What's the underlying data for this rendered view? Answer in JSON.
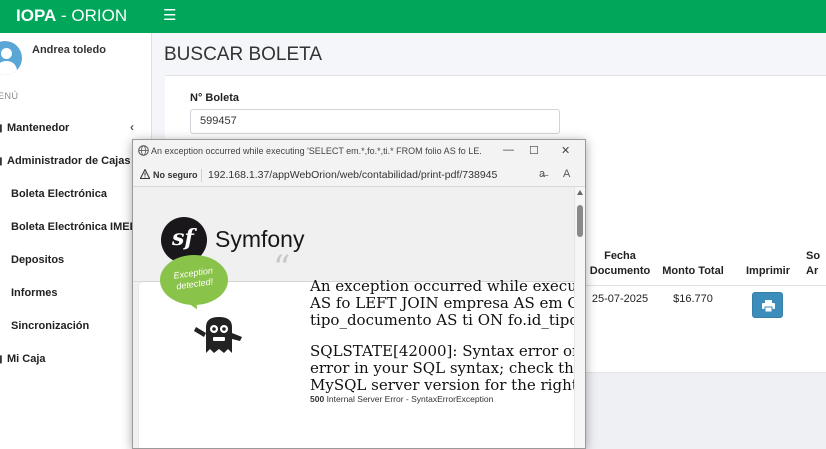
{
  "brand": {
    "bold": "IOPA",
    "rest": " - ORION"
  },
  "sidebar": {
    "user_name": "Andrea toledo",
    "menu_header": "ENÚ",
    "items": [
      {
        "label": "Mantenedor"
      },
      {
        "label": "Administrador de Cajas"
      },
      {
        "label": "Boleta Electrónica"
      },
      {
        "label": "Boleta Electrónica IMED"
      },
      {
        "label": "Depositos"
      },
      {
        "label": "Informes"
      },
      {
        "label": "Sincronización"
      },
      {
        "label": "Mi Caja"
      }
    ]
  },
  "main": {
    "title": "BUSCAR BOLETA",
    "form": {
      "label": "N° Boleta",
      "value": "599457"
    },
    "table": {
      "headers": {
        "fecha": "Fecha Documento",
        "fecha_l1": "Fecha",
        "fecha_l2": "Documento",
        "monto": "Monto Total",
        "imprimir": "Imprimir",
        "next_l1": "So",
        "next_l2": "Ar"
      },
      "rows": [
        {
          "fecha": "25-07-2025",
          "monto": "$16.770"
        }
      ]
    }
  },
  "popup": {
    "title": "An exception occurred while executing 'SELECT em.*,fo.*,ti.* FROM folio AS fo LE...",
    "security": "No seguro",
    "url": "192.168.1.37/appWebOrion/web/contabilidad/print-pdf/738945",
    "framework": "Symfony",
    "badge": "Exception detected!",
    "badge_l1": "Exception",
    "badge_l2": "detected!",
    "message_lines": [
      "An exception occurred while executing '",
      "AS fo LEFT JOIN empresa AS em ON fo",
      "tipo_documento AS ti ON fo.id_tipo_do"
    ],
    "sql_lines": [
      "SQLSTATE[42000]: Syntax error or acc",
      "error in your SQL syntax; check the ma",
      "MySQL server version for the right synt"
    ],
    "status_code": "500",
    "status_text": "Internal Server Error - SyntaxErrorException"
  },
  "colors": {
    "topbar": "#00a65a",
    "print_button": "#3c8dbc",
    "badge": "#8ac34a"
  }
}
